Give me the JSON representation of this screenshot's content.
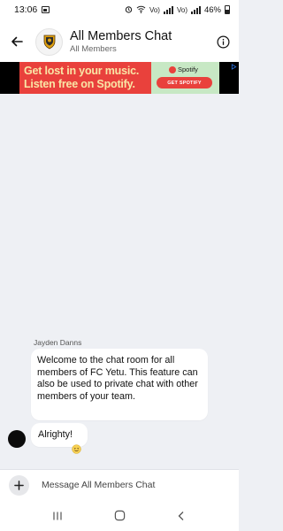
{
  "status_bar": {
    "time": "13:06",
    "battery_text": "46%",
    "icons": [
      "gallery-icon",
      "alarm-icon",
      "wifi-icon",
      "volte-icon",
      "signal-icon",
      "battery-icon"
    ],
    "network_labels": [
      "Vo)",
      "Vo)"
    ]
  },
  "header": {
    "title": "All Members Chat",
    "subtitle": "All Members",
    "back_icon": "arrow-left-icon",
    "info_icon": "info-icon",
    "crest_color": "#e0a10f"
  },
  "ad": {
    "line1": "Get lost in your music.",
    "line2": "Listen free on Spotify.",
    "brand": "Spotify",
    "cta": "GET SPOTIFY",
    "background": "#e9413c",
    "panel_color": "#c7e8c4",
    "text_color": "#f9e6a6"
  },
  "chat": {
    "sender": "Jayden Danns",
    "messages": [
      {
        "text": "Welcome to the chat room for all members of FC Yetu. This feature can also be used to private chat with other members of your team."
      },
      {
        "text": "Alrighty!",
        "reaction": "smile-emoji"
      }
    ]
  },
  "composer": {
    "add_icon": "plus-icon",
    "placeholder": "Message All Members Chat"
  },
  "nav": {
    "recents_icon": "recents-icon",
    "home_icon": "home-icon",
    "back_icon": "back-chevron-icon"
  }
}
